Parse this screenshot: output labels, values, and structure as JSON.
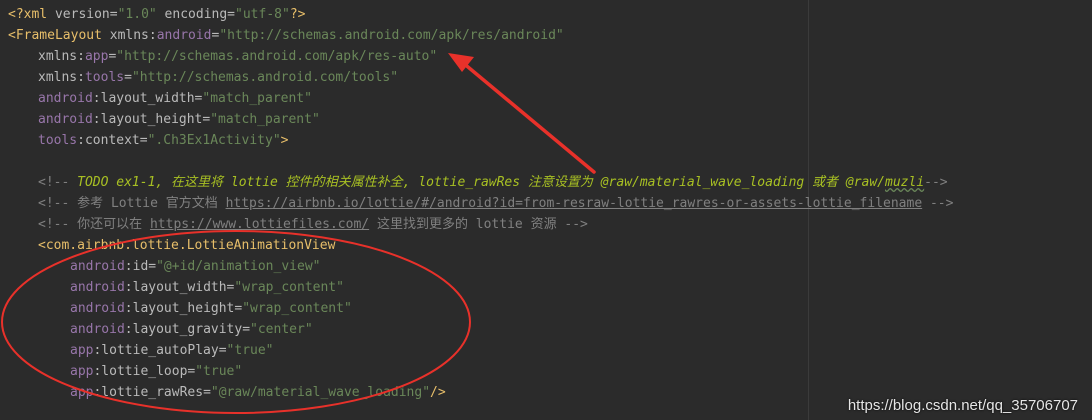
{
  "code": {
    "xml_decl": {
      "open": "<?",
      "name": "xml",
      "attr1": " version=",
      "val1": "\"1.0\"",
      "attr2": " encoding=",
      "val2": "\"utf-8\"",
      "close": "?>"
    },
    "frame_open": {
      "tag": "<FrameLayout",
      "ns": " xmlns:",
      "attr": "android",
      "eq": "=",
      "val": "\"http://schemas.android.com/apk/res/android\""
    },
    "app_ns": {
      "prefix": "xmlns:",
      "name": "app",
      "eq": "=",
      "val": "\"http://schemas.android.com/apk/res-auto\""
    },
    "tools_ns": {
      "prefix": "xmlns:",
      "name": "tools",
      "eq": "=",
      "val": "\"http://schemas.android.com/tools\""
    },
    "frame_width": {
      "ns": "android",
      "attr": ":layout_width",
      "eq": "=",
      "val": "\"match_parent\""
    },
    "frame_height": {
      "ns": "android",
      "attr": ":layout_height",
      "eq": "=",
      "val": "\"match_parent\""
    },
    "frame_context": {
      "ns": "tools",
      "attr": ":context",
      "eq": "=",
      "val": "\".Ch3Ex1Activity\"",
      "close": ">"
    },
    "comment1": {
      "open": "<!-- ",
      "text": "TODO ex1-1, 在这里将 lottie 控件的相关属性补全, lottie_rawRes 注意设置为 @raw/material_wave_loading 或者 @raw/",
      "link": "muzli",
      "close": "-->"
    },
    "comment2": {
      "open": "<!-- 参考 Lottie 官方文档 ",
      "link": "https://airbnb.io/lottie/#/android?id=from-resraw-lottie_rawres-or-assets-lottie_filename",
      "close": " -->"
    },
    "comment3": {
      "open": "<!-- 你还可以在 ",
      "link": "https://www.lottiefiles.com/",
      "close": " 这里找到更多的 lottie 资源 -->"
    },
    "lottie_open": {
      "tag": "<com.airbnb.lottie.LottieAnimationView"
    },
    "lottie_attrs": [
      {
        "ns": "android",
        "attr": ":id",
        "eq": "=",
        "val": "\"@+id/animation_view\"",
        "close": ""
      },
      {
        "ns": "android",
        "attr": ":layout_width",
        "eq": "=",
        "val": "\"wrap_content\"",
        "close": ""
      },
      {
        "ns": "android",
        "attr": ":layout_height",
        "eq": "=",
        "val": "\"wrap_content\"",
        "close": ""
      },
      {
        "ns": "android",
        "attr": ":layout_gravity",
        "eq": "=",
        "val": "\"center\"",
        "close": ""
      },
      {
        "ns": "app",
        "attr": ":lottie_autoPlay",
        "eq": "=",
        "val": "\"true\"",
        "close": ""
      },
      {
        "ns": "app",
        "attr": ":lottie_loop",
        "eq": "=",
        "val": "\"true\"",
        "close": ""
      },
      {
        "ns": "app",
        "attr": ":lottie_rawRes",
        "eq": "=",
        "val": "\"@raw/material_wave_loading\"",
        "close": "/>"
      }
    ]
  },
  "watermark": "https://blog.csdn.net/qq_35706707",
  "annotation_color": "#e8312a"
}
